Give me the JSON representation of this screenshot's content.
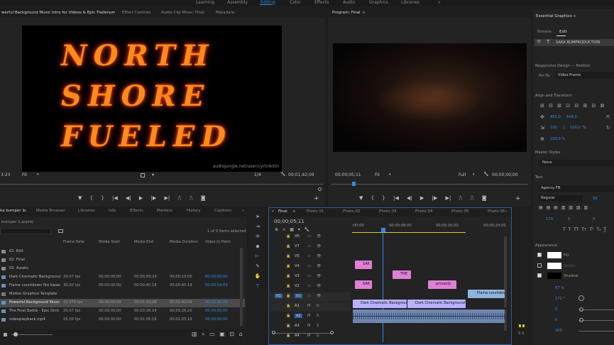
{
  "workspaces": [
    "Learning",
    "Assembly",
    "Editing",
    "Color",
    "Effects",
    "Audio",
    "Graphics",
    "Libraries"
  ],
  "workspace_more": "»",
  "source": {
    "tabs": [
      "werful Background Music Intro for Videos & Epic Trailers.mp4",
      "Effect Controls",
      "Audio Clip Mixer: Final",
      "Metadata"
    ],
    "tab_menu": "≡",
    "timecode": "3:23",
    "fit": "Fit",
    "fraction": "1/4",
    "duration": "00;01;42;09",
    "watermark": "audiojungle.net/user/cyrlinkitin",
    "art_lines": [
      "NORTH",
      "SHORE",
      "FUELED"
    ]
  },
  "program": {
    "title": "Program: Final",
    "tab_menu": "≡",
    "timecode": "00;00;05;11",
    "fit": "Fit",
    "quality": "Full",
    "duration": "00;00;00;00"
  },
  "project": {
    "tabs": [
      "ka bumper 1",
      "Media Browser",
      "Libraries",
      "Info",
      "Effects",
      "Markers",
      "History",
      "Captions"
    ],
    "tabs_more": "»",
    "tab_menu": "≡",
    "path": "bumper 1.prproj",
    "selected_info": "1 of 9 items selected",
    "columns": [
      "Frame Rate",
      "Media Start",
      "Media End",
      "Media Duration",
      "Video In Point"
    ],
    "rows": [
      {
        "name": "01. Edit",
        "fr": "",
        "ms": "",
        "me": "",
        "md": "",
        "vi": ""
      },
      {
        "name": "02. Final",
        "fr": "",
        "ms": "",
        "me": "",
        "md": "",
        "vi": ""
      },
      {
        "name": "03. Assets",
        "fr": "",
        "ms": "",
        "me": "",
        "md": "",
        "vi": ""
      },
      {
        "name": "Dark Cinematic Background",
        "fr": "29,97 fps",
        "ms": "00;00;00;00",
        "me": "00;00;09;29",
        "md": "00;00;10;00",
        "vi": "00;00;00;00"
      },
      {
        "name": "Flame countdown fire based",
        "fr": "30,00 fps",
        "ms": "00:00:00:00",
        "me": "00:00:45:18",
        "md": "00:00:45:19",
        "vi": "00:00:14:09"
      },
      {
        "name": "Motion Graphics Template",
        "fr": "",
        "ms": "",
        "me": "",
        "md": "",
        "vi": ""
      },
      {
        "name": "Powerful Background Music",
        "fr": "23,976 fps",
        "ms": "00;00;00;00",
        "me": "00;01;42;08",
        "md": "00;01;42;09",
        "vi": "00;00;00;00"
      },
      {
        "name": "The Final Battle - Epic Orch",
        "fr": "29,97 fps",
        "ms": "00;00;00;00",
        "me": "00;03;26;19",
        "md": "00;03;26;20",
        "vi": "00;00;00;00"
      },
      {
        "name": "videoplayback.mp4",
        "fr": "25,00 fps",
        "ms": "00:00:00:00",
        "me": "00:01:05:18",
        "md": "00:01:05:19",
        "vi": "00:00:00:00"
      }
    ]
  },
  "timeline": {
    "tab": "Final",
    "tab_close": "×",
    "tab_menu": "≡",
    "tabs": [
      "Photo 01",
      "Photo 02",
      "Photo 03",
      "Photo 04",
      "Photo 05",
      "Photo 06"
    ],
    "tabs_more": "»",
    "timecode": "00;00;05;11",
    "ruler": [
      ";00;00",
      "00;00;08;00",
      "00;00;16;00",
      "00;00;24;00"
    ],
    "tracks": [
      "V6",
      "V7",
      "V5",
      "V4",
      "V3",
      "V2",
      "V1",
      "A1",
      "A2",
      "A3",
      "A4"
    ],
    "src_v": "V1",
    "src_a": "A1",
    "clips": {
      "v5": "SAK",
      "v4": "THE",
      "v3a": "SAK",
      "v3b": "prosesty",
      "v2": "Flame countdow",
      "v1a": "Dark Cinematic Background -",
      "v1b": "Dark Cinematic Background - 100"
    }
  },
  "essential": {
    "title": "Essential Graphics",
    "tab_menu": "≡",
    "tabs": [
      "Browse",
      "Edit"
    ],
    "layer": "SAKA BUMPRODUCTION",
    "responsive": "Responsive Design — Position",
    "pin_to_label": "Pin To:",
    "pin_to": "Video Frame",
    "align": "Align and Transform",
    "pos_x": "955,0",
    "pos_y": "548,0",
    "scale": "100",
    "scale2": "100,0",
    "scale_pct": "%",
    "rot": "0",
    "opacity": "100,0 %",
    "master": "Master Styles",
    "master_val": "None",
    "text": "Text",
    "font": "Agency FB",
    "style": "Regular",
    "size": "50",
    "kern": "170",
    "lead": "0",
    "track": "0",
    "appearance": "Appearance",
    "fill": "Fill",
    "stroke": "Stroke",
    "shadow": "Shadow",
    "shadow_vals": [
      "87 %",
      "172 °",
      "0",
      "0",
      "300"
    ],
    "tri_right": "▸",
    "cursor_icon": "⇱"
  },
  "audio_meter": "S S"
}
